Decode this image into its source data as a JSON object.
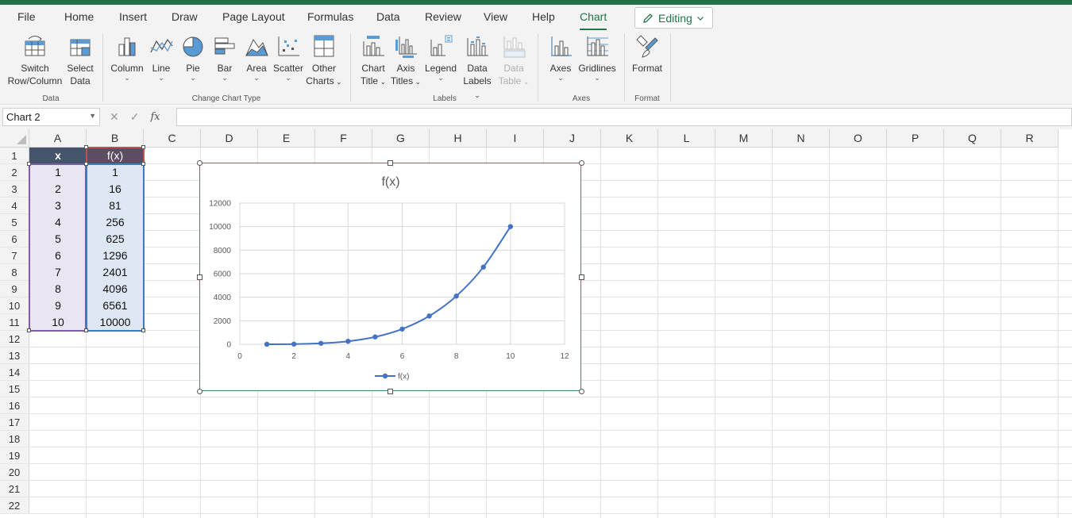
{
  "menu": {
    "tabs": [
      "File",
      "Home",
      "Insert",
      "Draw",
      "Page Layout",
      "Formulas",
      "Data",
      "Review",
      "View",
      "Help",
      "Chart"
    ],
    "active_tab": "Chart",
    "editing_label": "Editing"
  },
  "ribbon": {
    "groups": {
      "data": "Data",
      "change_chart_type": "Change Chart Type",
      "labels": "Labels",
      "axes": "Axes",
      "format": "Format"
    },
    "buttons": {
      "switch": [
        "Switch",
        "Row/Column"
      ],
      "select": [
        "Select",
        "Data"
      ],
      "column": "Column",
      "line": "Line",
      "pie": "Pie",
      "bar": "Bar",
      "area": "Area",
      "scatter": "Scatter",
      "other": [
        "Other",
        "Charts"
      ],
      "chart_title": [
        "Chart",
        "Title"
      ],
      "axis_titles": [
        "Axis",
        "Titles"
      ],
      "legend": "Legend",
      "data_labels": [
        "Data",
        "Labels"
      ],
      "data_table": [
        "Data",
        "Table"
      ],
      "axes": "Axes",
      "gridlines": "Gridlines",
      "format": "Format"
    }
  },
  "formula_bar": {
    "name_box": "Chart 2",
    "fx": "fx",
    "value": ""
  },
  "sheet": {
    "columns": [
      "A",
      "B",
      "C",
      "D",
      "E",
      "F",
      "G",
      "H",
      "I",
      "J",
      "K",
      "L",
      "M",
      "N",
      "O",
      "P",
      "Q",
      "R"
    ],
    "rows": [
      "1",
      "2",
      "3",
      "4",
      "5",
      "6",
      "7",
      "8",
      "9",
      "10",
      "11",
      "12",
      "13",
      "14",
      "15",
      "16",
      "17",
      "18",
      "19",
      "20",
      "21",
      "22"
    ],
    "header": {
      "a": "x",
      "b": "f(x)"
    },
    "col_a": [
      "1",
      "2",
      "3",
      "4",
      "5",
      "6",
      "7",
      "8",
      "9",
      "10"
    ],
    "col_b": [
      "1",
      "16",
      "81",
      "256",
      "625",
      "1296",
      "2401",
      "4096",
      "6561",
      "10000"
    ]
  },
  "chart_data": {
    "type": "scatter",
    "title": "f(x)",
    "series": [
      {
        "name": "f(x)",
        "x": [
          1,
          2,
          3,
          4,
          5,
          6,
          7,
          8,
          9,
          10
        ],
        "y": [
          1,
          16,
          81,
          256,
          625,
          1296,
          2401,
          4096,
          6561,
          10000
        ]
      }
    ],
    "xlim": [
      0,
      12
    ],
    "ylim": [
      0,
      12000
    ],
    "xticks": [
      "0",
      "2",
      "4",
      "6",
      "8",
      "10",
      "12"
    ],
    "yticks": [
      "0",
      "2000",
      "4000",
      "6000",
      "8000",
      "10000",
      "12000"
    ],
    "grid": true,
    "smooth_line": true,
    "markers": true,
    "legend": "bottom",
    "color": "#4472c4"
  }
}
